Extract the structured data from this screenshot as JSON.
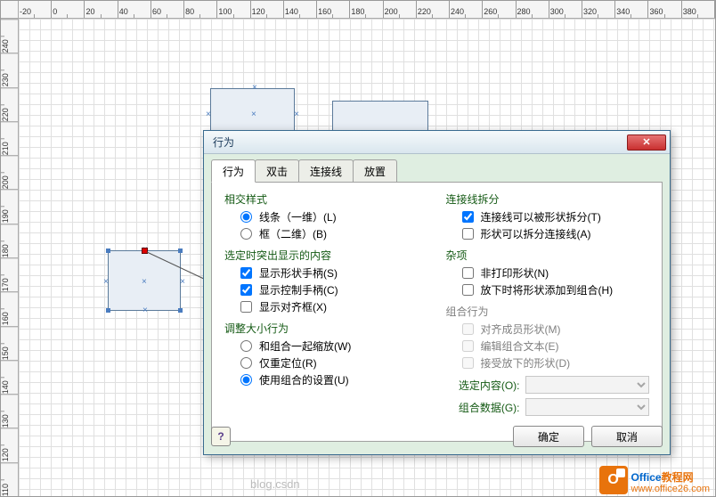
{
  "ruler_h": [
    "-20",
    "0",
    "20",
    "40",
    "60",
    "80",
    "100",
    "120",
    "140",
    "160",
    "180",
    "200",
    "220",
    "240",
    "260",
    "280",
    "300",
    "320",
    "340",
    "360",
    "380"
  ],
  "ruler_v": [
    "240",
    "230",
    "220",
    "210",
    "200",
    "190",
    "180",
    "170",
    "160",
    "150",
    "140",
    "130",
    "120",
    "110"
  ],
  "dialog": {
    "title": "行为",
    "tabs": [
      "行为",
      "双击",
      "连接线",
      "放置"
    ],
    "group1": {
      "legend": "相交样式",
      "opt1": "线条（一维）(L)",
      "opt2": "框（二维）(B)"
    },
    "group2": {
      "legend": "选定时突出显示的内容",
      "opt1": "显示形状手柄(S)",
      "opt2": "显示控制手柄(C)",
      "opt3": "显示对齐框(X)"
    },
    "group3": {
      "legend": "调整大小行为",
      "opt1": "和组合一起缩放(W)",
      "opt2": "仅重定位(R)",
      "opt3": "使用组合的设置(U)"
    },
    "group4": {
      "legend": "连接线拆分",
      "opt1": "连接线可以被形状拆分(T)",
      "opt2": "形状可以拆分连接线(A)"
    },
    "group5": {
      "legend": "杂项",
      "opt1": "非打印形状(N)",
      "opt2": "放下时将形状添加到组合(H)"
    },
    "group6": {
      "legend": "组合行为",
      "opt1": "对齐成员形状(M)",
      "opt2": "编辑组合文本(E)",
      "opt3": "接受放下的形状(D)",
      "sel_label": "选定内容(O):",
      "data_label": "组合数据(G):"
    },
    "ok": "确定",
    "cancel": "取消"
  },
  "branding": {
    "watermark": "blog.csdn",
    "name_part1": "Office",
    "name_part2": "教程网",
    "url": "www.office26.com"
  }
}
